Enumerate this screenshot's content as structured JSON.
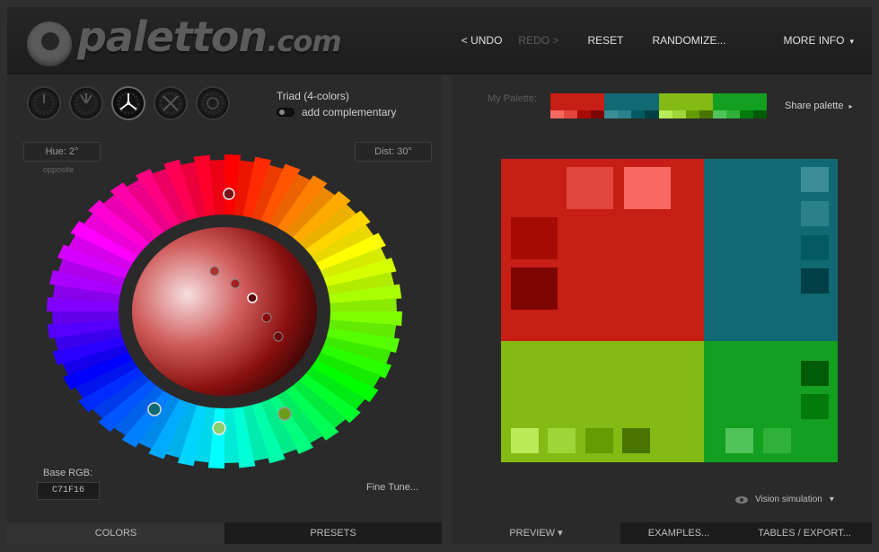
{
  "header": {
    "logo_main": "paletton",
    "logo_tld": ".com",
    "nav": {
      "undo": "< UNDO",
      "redo": "REDO >",
      "reset": "RESET",
      "randomize": "RANDOMIZE...",
      "more_info": "MORE INFO",
      "more_info_caret": "▾"
    }
  },
  "left": {
    "scheme_title": "Triad (4-colors)",
    "add_complementary": "add complementary",
    "hue": "Hue: 2°",
    "dist": "Dist: 30°",
    "opposite": "opposite",
    "base_rgb_label": "Base RGB:",
    "base_rgb_value": "C71F16",
    "fine_tune": "Fine Tune...",
    "tabs": {
      "colors": "COLORS",
      "presets": "PRESETS"
    }
  },
  "right": {
    "my_palette_label": "My Palette:",
    "share_palette": "Share palette",
    "share_caret": "▸",
    "vision_simulation": "Vision simulation",
    "vision_caret": "▾",
    "tabs": {
      "preview": "PREVIEW",
      "preview_caret": "▾",
      "examples": "EXAMPLES...",
      "tables": "TABLES / EXPORT..."
    }
  },
  "palette": {
    "red": {
      "main": "#C71F16",
      "light2": "#F96861",
      "light1": "#E3463E",
      "dark1": "#A70C04",
      "dark2": "#7D0500"
    },
    "teal": {
      "main": "#116A73",
      "light2": "#3B8E96",
      "light1": "#2B8189",
      "dark1": "#035A62",
      "dark2": "#003F45"
    },
    "lime": {
      "main": "#83BA14",
      "light2": "#B8EB56",
      "light1": "#9ED538",
      "dark1": "#649C02",
      "dark2": "#4A7400"
    },
    "green": {
      "main": "#139F1F",
      "light2": "#50C45A",
      "light1": "#2FB13A",
      "dark1": "#037A0C",
      "dark2": "#005B07"
    }
  }
}
